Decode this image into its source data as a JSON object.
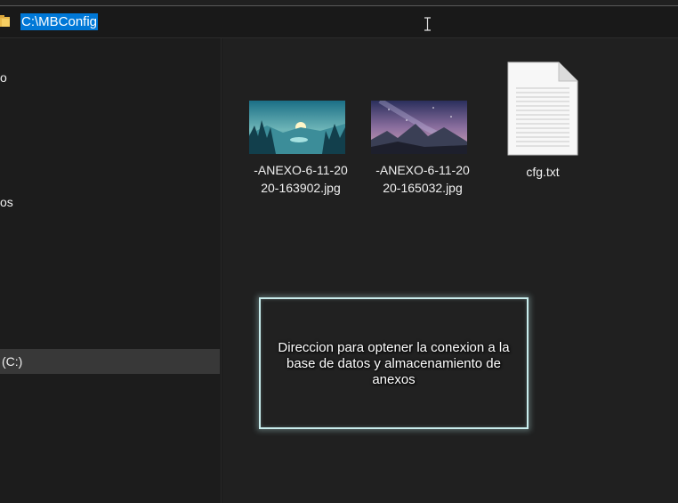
{
  "address_bar": {
    "path": "C:\\MBConfig",
    "icon": "folder-icon"
  },
  "sidebar": {
    "items": [
      {
        "label": "o"
      },
      {
        "label": "os"
      },
      {
        "label": "(C:)",
        "selected": true
      }
    ]
  },
  "files": [
    {
      "name_line1": "-ANEXO-6-11-20",
      "name_line2": "20-163902.jpg",
      "icon": "image-thumbnail"
    },
    {
      "name_line1": "-ANEXO-6-11-20",
      "name_line2": "20-165032.jpg",
      "icon": "image-thumbnail"
    },
    {
      "name_line1": "cfg.txt",
      "icon": "text-file-icon"
    }
  ],
  "tooltip": {
    "text": "Direccion para optener la conexion a la base de datos y almacenamiento de anexos"
  },
  "colors": {
    "selection": "#0078d7",
    "background": "#191919",
    "tooltip_border": "#c8ecec"
  }
}
